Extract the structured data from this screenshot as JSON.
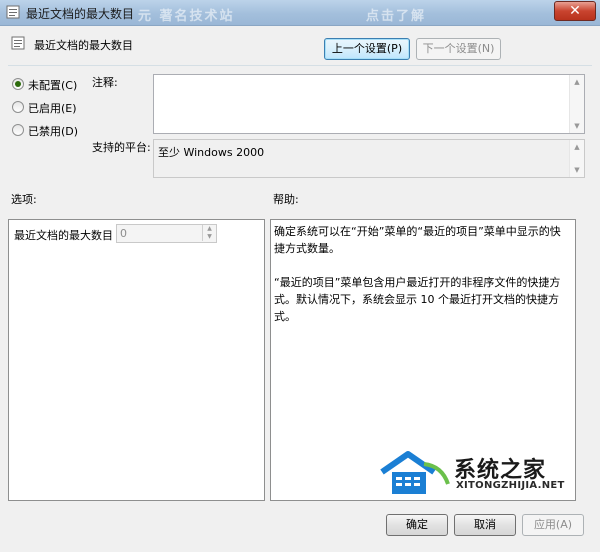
{
  "window": {
    "title": "最近文档的最大数目",
    "watermark": "元 著名技术站",
    "watermark2": "点击了解"
  },
  "header": {
    "title": "最近文档的最大数目",
    "prev_label": "上一个设置(P)",
    "next_label": "下一个设置(N)"
  },
  "state": {
    "options": [
      {
        "label": "未配置(C)",
        "selected": true
      },
      {
        "label": "已启用(E)",
        "selected": false
      },
      {
        "label": "已禁用(D)",
        "selected": false
      }
    ]
  },
  "comment": {
    "label": "注释:",
    "value": ""
  },
  "platform": {
    "label": "支持的平台:",
    "value": "至少 Windows 2000"
  },
  "options_section": {
    "label": "选项:",
    "field_label": "最近文档的最大数目",
    "field_value": "0"
  },
  "help_section": {
    "label": "帮助:",
    "paragraphs": [
      "确定系统可以在“开始”菜单的“最近的项目”菜单中显示的快捷方式数量。",
      "“最近的项目”菜单包含用户最近打开的非程序文件的快捷方式。默认情况下，系统会显示 10 个最近打开文档的快捷方式。"
    ]
  },
  "footer": {
    "ok_label": "确定",
    "cancel_label": "取消",
    "apply_label": "应用(A)"
  },
  "logo": {
    "cn": "系统之家",
    "en": "XITONGZHIJIA.NET"
  },
  "colors": {
    "accent": "#3c7fb1",
    "titlebar": "#a3bfdc",
    "close": "#c9442f",
    "logo_blue": "#1b7fd4"
  }
}
